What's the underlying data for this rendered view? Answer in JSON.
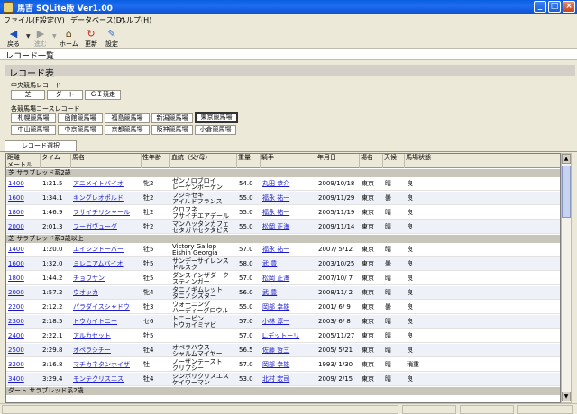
{
  "window": {
    "title": "馬吉 SQLite版 Ver1.00"
  },
  "menu": [
    "ファイル(F)",
    "設定(V)",
    "データベース(D)",
    "ヘルプ(H)"
  ],
  "toolbar": {
    "back": "戻る",
    "forward": "進む",
    "home": "ホーム",
    "refresh": "更新",
    "settings": "設定"
  },
  "page_title": "レコード一覧",
  "section_title": "レコード表",
  "central": {
    "label": "中央競馬レコード",
    "buttons": [
      "芝",
      "ダート",
      "ＧＩ競走"
    ]
  },
  "tracks": {
    "label": "各競馬場コースレコード",
    "row1": [
      "札幌競馬場",
      "函館競馬場",
      "福島競馬場",
      "新潟競馬場",
      "東京競馬場"
    ],
    "row2": [
      "中山競馬場",
      "中京競馬場",
      "京都競馬場",
      "阪神競馬場",
      "小倉競馬場"
    ],
    "selected": "東京競馬場"
  },
  "tab": "レコード選択",
  "table": {
    "headers": [
      "距離\nメートル",
      "タイム",
      "馬名",
      "性年齢",
      "血統（父/母）",
      "重量",
      "騎手",
      "年月日",
      "場名",
      "天候",
      "馬場状態"
    ],
    "groups": [
      {
        "title": "芝 サラブレッド系2歳",
        "rows": [
          [
            "1400",
            "1:21.5",
            "アニメイトバイオ",
            "牝2",
            "ゼンノロブロイ\nレーゲンボーゲン",
            "54.0",
            "丸田 恭介",
            "2009/10/18",
            "東京",
            "晴",
            "良"
          ],
          [
            "1600",
            "1:34.1",
            "キングレオポルド",
            "牡2",
            "フジキセキ\nアイルドフランス",
            "55.0",
            "福永 祐一",
            "2009/11/29",
            "東京",
            "曇",
            "良"
          ],
          [
            "1800",
            "1:46.9",
            "フサイチリシャール",
            "牡2",
            "クロフネ\nフサイチエアデール",
            "55.0",
            "福永 祐一",
            "2005/11/19",
            "東京",
            "晴",
            "良"
          ],
          [
            "2000",
            "2:01.3",
            "フーガヴューグ",
            "牡2",
            "マンハッタンカフェ\nセタガヤセクタビス",
            "55.0",
            "松岡 正海",
            "2009/11/14",
            "東京",
            "晴",
            "良"
          ]
        ]
      },
      {
        "title": "芝 サラブレッド系3歳以上",
        "rows": [
          [
            "1400",
            "1:20.0",
            "エイシンドーバー",
            "牡5",
            "Victory Gallop\nEishin Georgia",
            "57.0",
            "福永 祐一",
            "2007/ 5/12",
            "東京",
            "晴",
            "良"
          ],
          [
            "1600",
            "1:32.0",
            "ミレニアムバイオ",
            "牡5",
            "サンデーサイレンス\nドルスク",
            "58.0",
            "武 豊",
            "2003/10/25",
            "東京",
            "曇",
            "良"
          ],
          [
            "1800",
            "1:44.2",
            "チョウサン",
            "牡5",
            "ダンスインザダーク\nスティンガー",
            "57.0",
            "松岡 正海",
            "2007/10/ 7",
            "東京",
            "晴",
            "良"
          ],
          [
            "2000",
            "1:57.2",
            "ウオッカ",
            "牝4",
            "タニノギムレット\nタニノシスター",
            "56.0",
            "武 豊",
            "2008/11/ 2",
            "東京",
            "晴",
            "良"
          ],
          [
            "2200",
            "2:12.2",
            "パラダイスシャドウ",
            "牡3",
            "ウォーニング\nハーディーグロウル",
            "55.0",
            "岡部 幸雄",
            "2001/ 6/ 9",
            "東京",
            "曇",
            "良"
          ],
          [
            "2300",
            "2:18.5",
            "トウカイトニー",
            "セ6",
            "トニービン\nトウカイミヤビ",
            "57.0",
            "小林 淳一",
            "2003/ 6/ 8",
            "東京",
            "晴",
            "良"
          ],
          [
            "2400",
            "2:22.1",
            "アルカセット",
            "牡5",
            "",
            "57.0",
            "L.デットーリ",
            "2005/11/27",
            "東京",
            "晴",
            "良"
          ],
          [
            "2500",
            "2:29.8",
            "オペラシチー",
            "牡4",
            "オペラハウス\nシャルムマイヤー",
            "56.5",
            "佐藤 哲三",
            "2005/ 5/21",
            "東京",
            "晴",
            "良"
          ],
          [
            "3200",
            "3:16.8",
            "マチカネタンホイザ",
            "牡",
            "ノーザンテースト\nクリプシー",
            "57.0",
            "岡部 幸雄",
            "1993/ 1/30",
            "東京",
            "晴",
            "稍重"
          ],
          [
            "3400",
            "3:29.4",
            "モンテクリスエス",
            "牡4",
            "シンボリクリスエス\nケイウーマン",
            "53.0",
            "北村 宏司",
            "2009/ 2/15",
            "東京",
            "晴",
            "良"
          ]
        ]
      },
      {
        "title": "ダート サラブレッド系2歳",
        "rows": []
      }
    ]
  }
}
